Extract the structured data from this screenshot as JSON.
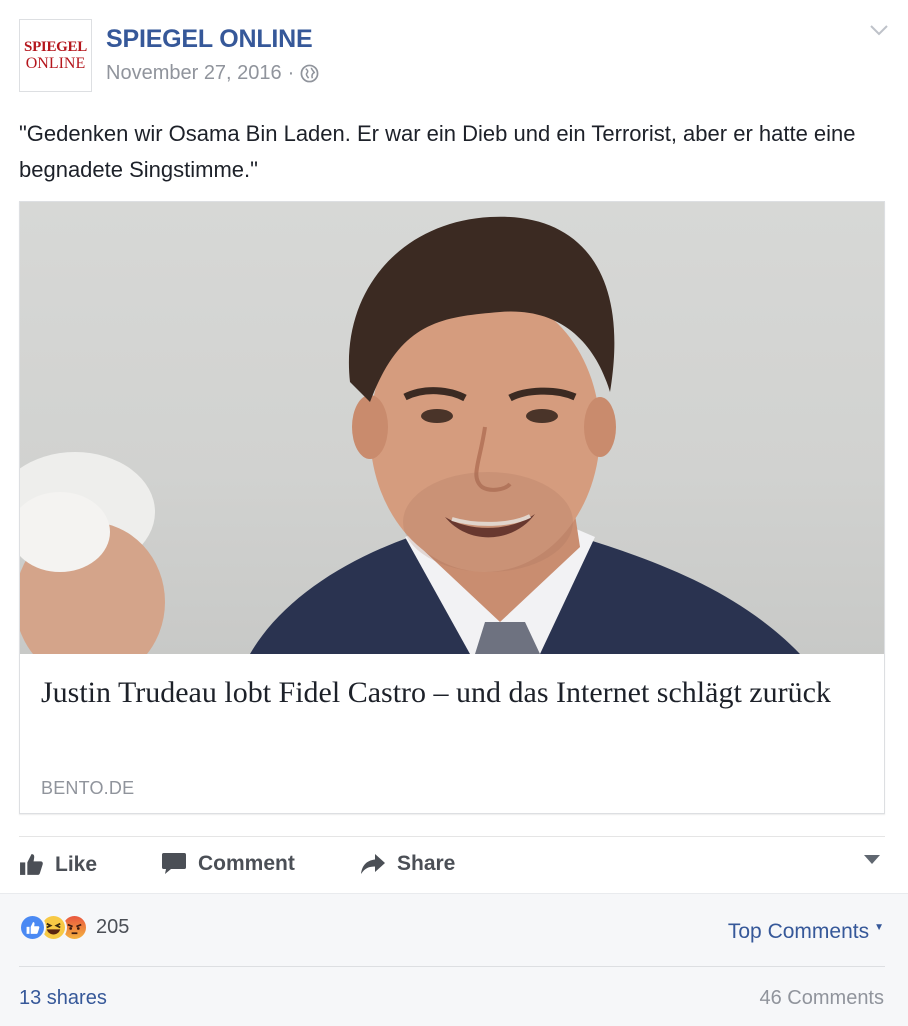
{
  "post": {
    "page_name": "SPIEGEL ONLINE",
    "avatar_line1": "SPIEGEL",
    "avatar_line2": "ONLINE",
    "date": "November 27, 2016",
    "separator": "·",
    "privacy_icon": "globe-icon",
    "menu_icon": "chevron-down-icon",
    "text": "\"Gedenken wir Osama Bin Laden. Er war ein Dieb und ein Terrorist, aber er hatte eine begnadete Singstimme.\""
  },
  "link_card": {
    "title": "Justin Trudeau lobt Fidel Castro – und das Internet schlägt zurück",
    "domain": "BENTO.DE"
  },
  "actions": {
    "like_label": "Like",
    "comment_label": "Comment",
    "share_label": "Share"
  },
  "footer": {
    "reaction_icons": [
      "like-reaction-icon",
      "haha-reaction-icon",
      "angry-reaction-icon"
    ],
    "reaction_count": "205",
    "top_comments_label": "Top Comments",
    "shares_label": "13 shares",
    "comments_label": "46 Comments"
  },
  "colors": {
    "link_blue": "#365899",
    "muted_gray": "#90949c",
    "action_gray": "#4b4f56",
    "brand_red": "#b5161d"
  }
}
